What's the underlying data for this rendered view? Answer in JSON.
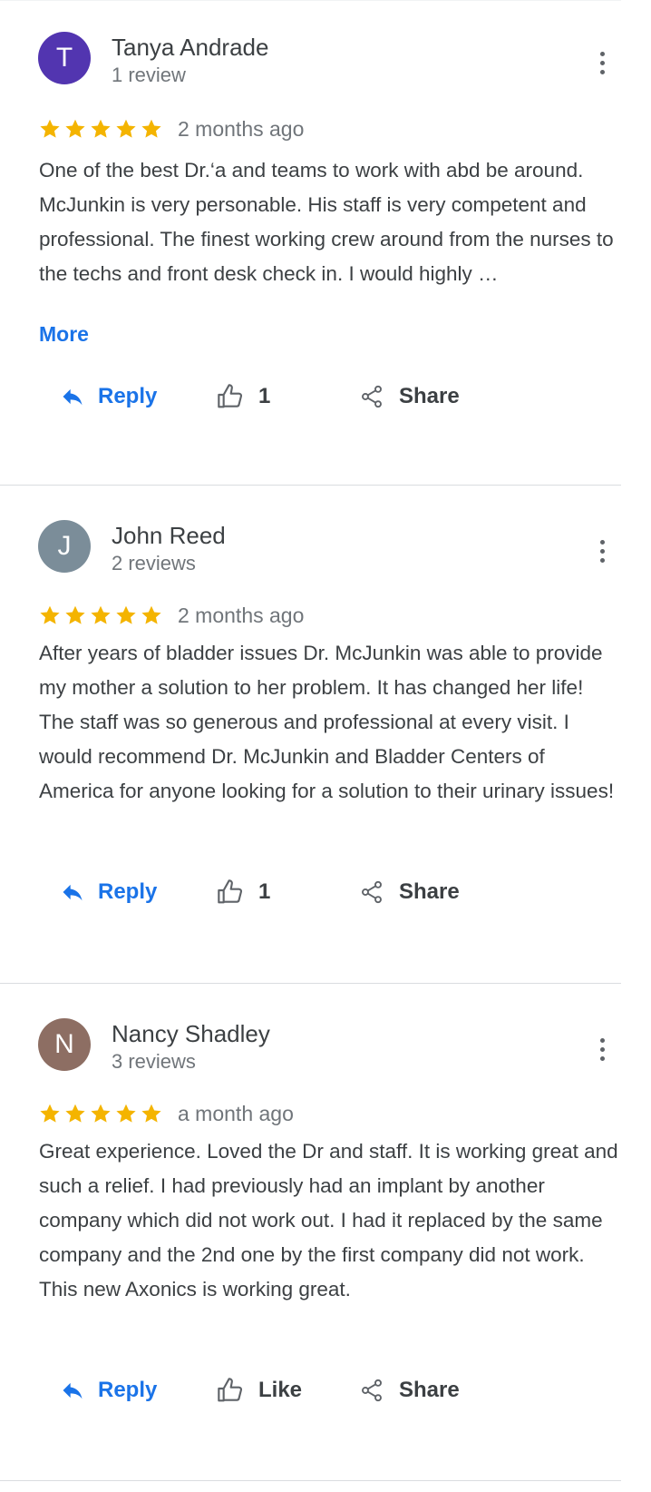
{
  "colors": {
    "star": "#f4b400",
    "link": "#1a73e8",
    "avatar_purple": "#5235b0",
    "avatar_gray": "#7b8d99",
    "avatar_brown": "#8d6e63"
  },
  "reviews": [
    {
      "avatar_letter": "T",
      "avatar_color": "#5235b0",
      "name": "Tanya Andrade",
      "meta": "1 review",
      "stars": 5,
      "date": "2 months ago",
      "text": "One of the best Dr.‘a and teams to work with abd be around. McJunkin  is very personable. His staff is very competent and professional. The finest working crew around from the nurses to the techs and front desk check in. I would highly …",
      "more_label": "More",
      "reply_label": "Reply",
      "like_label": "1",
      "share_label": "Share"
    },
    {
      "avatar_letter": "J",
      "avatar_color": "#7b8d99",
      "name": "John Reed",
      "meta": "2 reviews",
      "stars": 5,
      "date": "2 months ago",
      "text": "After years of bladder issues Dr. McJunkin was able to provide my mother a solution to her problem. It has changed her life! The staff was so generous and professional at every visit. I would recommend Dr. McJunkin and Bladder Centers of America for anyone looking for a solution to their urinary issues!",
      "reply_label": "Reply",
      "like_label": "1",
      "share_label": "Share"
    },
    {
      "avatar_letter": "N",
      "avatar_color": "#8d6e63",
      "name": "Nancy Shadley",
      "meta": "3 reviews",
      "stars": 5,
      "date": "a month ago",
      "text": "Great experience.  Loved the Dr and staff.  It is working great and such a relief.  I had previously had an implant by another company which did not work out.  I had it replaced by the same company and the 2nd one by the first company did not work.  This new Axonics is working great.",
      "reply_label": "Reply",
      "like_label": "Like",
      "share_label": "Share"
    }
  ]
}
